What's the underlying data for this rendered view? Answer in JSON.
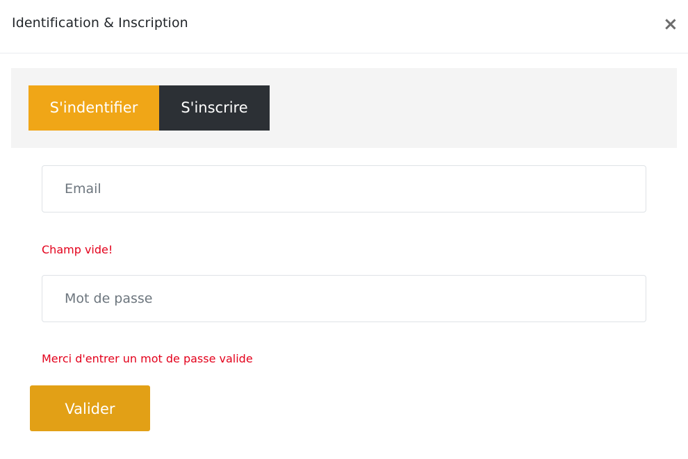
{
  "modal": {
    "title": "Identification & Inscription",
    "close_symbol": "×"
  },
  "tabs": [
    {
      "label": "S'indentifier",
      "active": true,
      "color": "#f0a617"
    },
    {
      "label": "S'inscrire",
      "active": false,
      "color": "#2c3035"
    }
  ],
  "form": {
    "email": {
      "placeholder": "Email",
      "value": "",
      "error": "Champ vide!"
    },
    "password": {
      "placeholder": "Mot de passe",
      "value": "",
      "error": "Merci d'entrer un mot de passe valide"
    },
    "submit_label": "Valider"
  },
  "colors": {
    "accent": "#f0a617",
    "dark": "#2c3035",
    "error": "#e3001b"
  }
}
